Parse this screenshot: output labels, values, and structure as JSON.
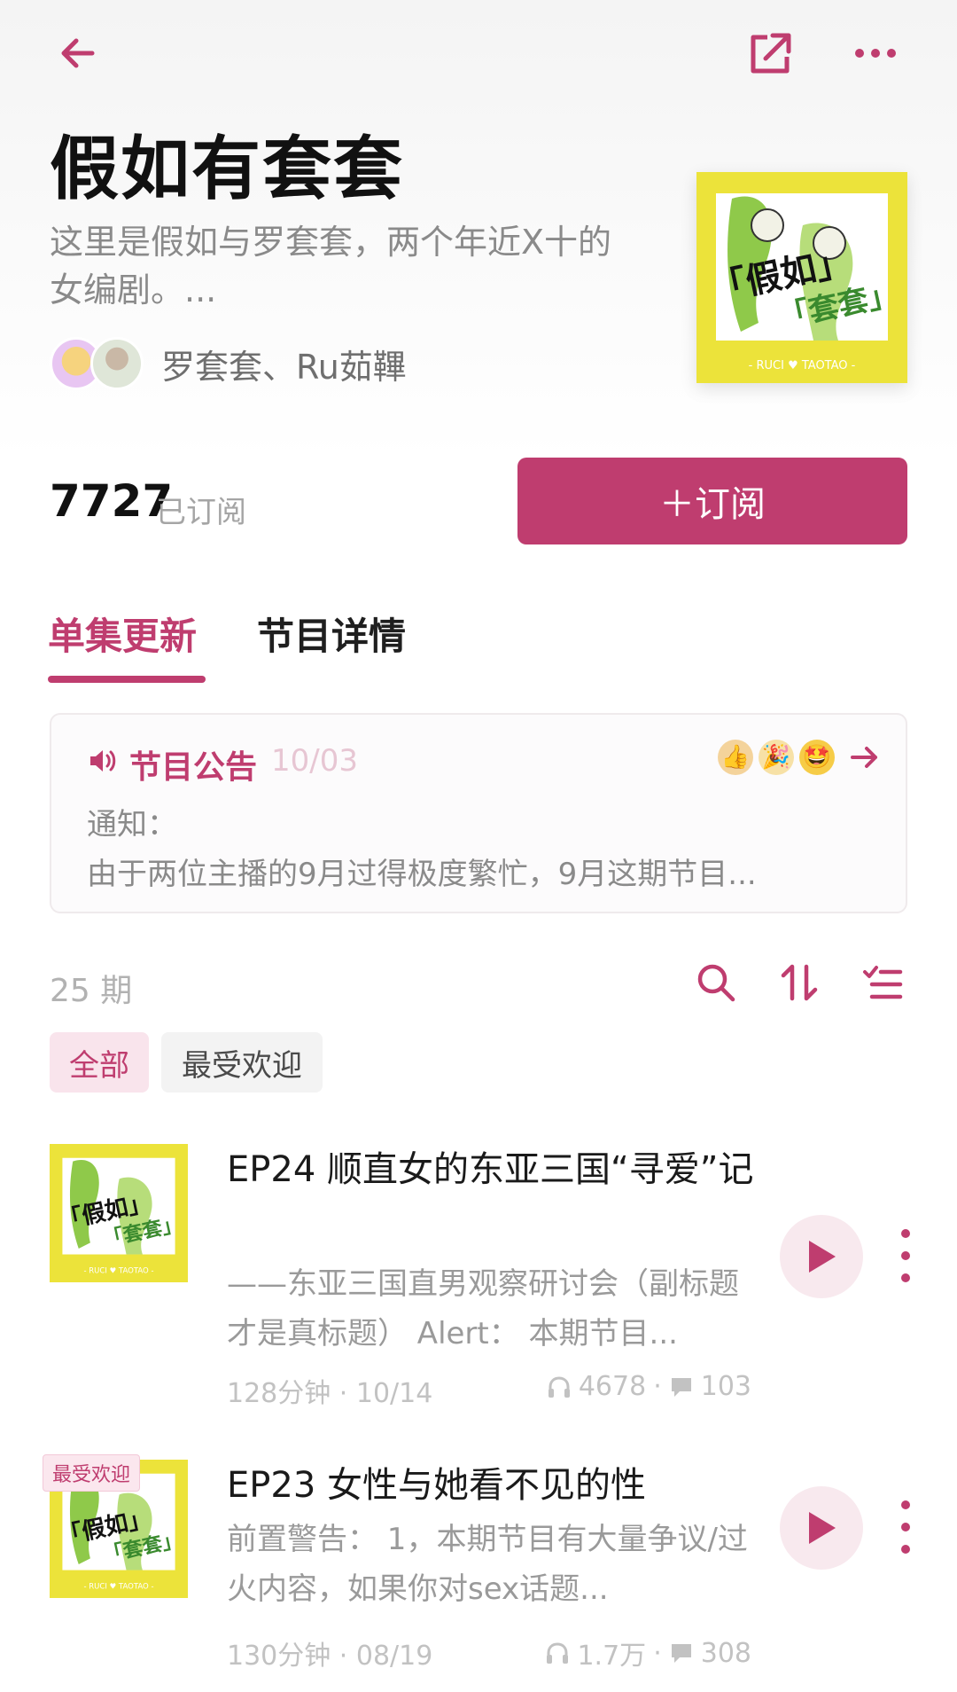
{
  "podcast": {
    "title": "假如有套套",
    "description": "这里是假如与罗套套，两个年近X十的女编剧。...",
    "hosts": "罗套套、Ru茹鞸",
    "cover_text_top": "「假如」",
    "cover_text_bottom": "「套套」",
    "cover_footer": "- RUCI ♥ TAOTAO -"
  },
  "subscription": {
    "count": "7727",
    "count_label": "已订阅",
    "button_label": "＋订阅"
  },
  "tabs": {
    "episodes": "单集更新",
    "details": "节目详情"
  },
  "notice": {
    "title": "节目公告",
    "date": "10/03",
    "line1": "通知：",
    "line2": "由于两位主播的9月过得极度繁忙，9月这期节目..."
  },
  "episode_list": {
    "count": "25 期",
    "filters": {
      "all": "全部",
      "popular": "最受欢迎"
    }
  },
  "episodes": [
    {
      "title": "EP24 顺直女的东亚三国“寻爱”记",
      "description": "——东亚三国直男观察研讨会（副标题才是真标题） Alert： 本期节目...",
      "meta": "128分钟 · 10/14",
      "plays": "4678",
      "comments": "103",
      "badge": ""
    },
    {
      "title": "EP23 女性与她看不见的性",
      "description": "前置警告： 1，本期节目有大量争议/过火内容，如果你对sex话题...",
      "meta": "130分钟 · 08/19",
      "plays": "1.7万",
      "comments": "308",
      "badge": "最受欢迎"
    }
  ],
  "colors": {
    "accent": "#bf3d6f",
    "cover_yellow": "#ece33a",
    "cover_green": "#8fc94a"
  }
}
